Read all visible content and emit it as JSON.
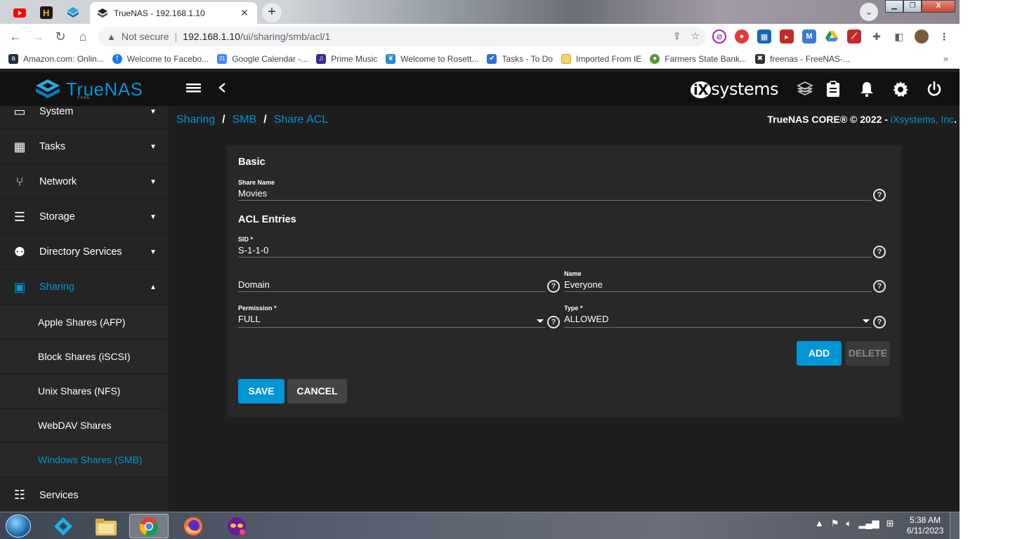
{
  "browser": {
    "active_tab_title": "TrueNAS - 192.168.1.10",
    "not_secure": "Not secure",
    "url_host": "192.168.1.10",
    "url_path": "/ui/sharing/smb/acl/1",
    "bookmarks": [
      {
        "label": "Amazon.com: Onlin...",
        "color": "#232f3e",
        "glyph": "a"
      },
      {
        "label": "Welcome to Facebo...",
        "color": "#1877f2",
        "glyph": "f"
      },
      {
        "label": "Google Calendar -...",
        "color": "#4285f4",
        "glyph": "31"
      },
      {
        "label": "Prime Music",
        "color": "#3b2a8c",
        "glyph": "♫"
      },
      {
        "label": "Welcome to Rosett...",
        "color": "#1f8ad8",
        "glyph": "❦"
      },
      {
        "label": "Tasks - To Do",
        "color": "#2f6fd6",
        "glyph": "✔"
      },
      {
        "label": "Imported From IE",
        "color": "#f4c542",
        "glyph": ""
      },
      {
        "label": "Farmers State Bank...",
        "color": "#4e9a3a",
        "glyph": "●"
      },
      {
        "label": "freenas - FreeNAS-...",
        "color": "#333333",
        "glyph": "✖"
      }
    ]
  },
  "header": {
    "logo": "TrueNAS",
    "logo_sub": "CORE",
    "brand": "systems",
    "brand_prefix": "iX"
  },
  "sidebar": {
    "items": [
      {
        "label": "System",
        "icon": "laptop-icon",
        "glyph": "▭"
      },
      {
        "label": "Tasks",
        "icon": "calendar-icon",
        "glyph": "▦"
      },
      {
        "label": "Network",
        "icon": "network-icon",
        "glyph": "⑂"
      },
      {
        "label": "Storage",
        "icon": "storage-icon",
        "glyph": "☰"
      },
      {
        "label": "Directory Services",
        "icon": "directory-icon",
        "glyph": "⚉"
      },
      {
        "label": "Sharing",
        "icon": "folder-shared-icon",
        "glyph": "▣"
      }
    ],
    "sharing_subitems": [
      "Apple Shares (AFP)",
      "Block Shares (iSCSI)",
      "Unix Shares (NFS)",
      "WebDAV Shares",
      "Windows Shares (SMB)"
    ],
    "services": {
      "label": "Services",
      "glyph": "☷"
    }
  },
  "breadcrumb": [
    "Sharing",
    "SMB",
    "Share ACL"
  ],
  "copyright": {
    "text": "TrueNAS CORE® © 2022 - ",
    "company": "iXsystems, Inc",
    "period": "."
  },
  "form": {
    "basic_title": "Basic",
    "share_name_label": "Share Name",
    "share_name_value": "Movies",
    "acl_title": "ACL Entries",
    "sid_label": "SID *",
    "sid_value": "S-1-1-0",
    "domain_placeholder": "Domain",
    "name_label": "Name",
    "name_value": "Everyone",
    "permission_label": "Permission *",
    "permission_value": "FULL",
    "type_label": "Type *",
    "type_value": "ALLOWED",
    "add_label": "ADD",
    "delete_label": "DELETE",
    "save_label": "SAVE",
    "cancel_label": "CANCEL"
  },
  "taskbar": {
    "time": "5:38 AM",
    "date": "6/11/2023"
  },
  "colors": {
    "accent": "#0095d5",
    "header_bg": "#111111",
    "sidebar_bg": "#242424",
    "card_bg": "#282828"
  }
}
